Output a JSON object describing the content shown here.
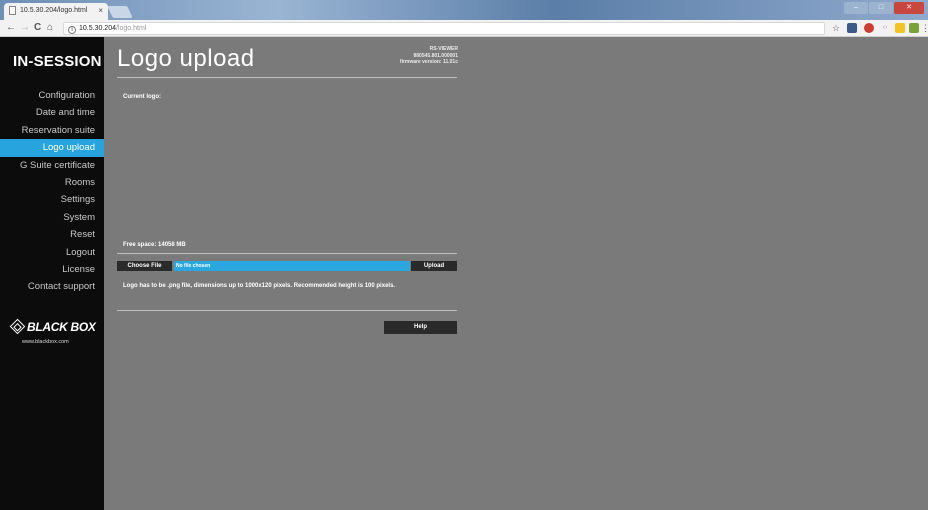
{
  "browser": {
    "tab_title": "10.5.30.204/logo.html",
    "tab_close": "×",
    "url_host": "10.5.30.204",
    "url_path": "/logo.html",
    "window_controls": {
      "minimize": "–",
      "maximize": "□",
      "close": "✕"
    },
    "nav": {
      "back": "←",
      "forward": "→",
      "reload": "C",
      "home": "⌂"
    },
    "info_icon": "i",
    "toolbar_icons": [
      "star-icon",
      "extension-icon",
      "adblock-icon",
      "code-icon",
      "notes-icon",
      "puzzle-icon",
      "menu-icon"
    ],
    "star_glyph": "☆",
    "menu_glyph": "⋮"
  },
  "sidebar": {
    "brand": "IN-SESSION",
    "items": [
      {
        "label": "Configuration",
        "active": false
      },
      {
        "label": "Date and time",
        "active": false
      },
      {
        "label": "Reservation suite",
        "active": false
      },
      {
        "label": "Logo upload",
        "active": true
      },
      {
        "label": "G Suite certificate",
        "active": false
      },
      {
        "label": "Rooms",
        "active": false
      },
      {
        "label": "Settings",
        "active": false
      },
      {
        "label": "System",
        "active": false
      },
      {
        "label": "Reset",
        "active": false
      },
      {
        "label": "Logout",
        "active": false
      },
      {
        "label": "License",
        "active": false
      },
      {
        "label": "Contact support",
        "active": false
      }
    ],
    "logo_text": "BLACK BOX",
    "logo_url": "www.blackbox.com"
  },
  "main": {
    "title": "Logo upload",
    "device": {
      "model": "RS-VIEWER",
      "serial": "880545.801.000001",
      "firmware": "firmware version: 11.01c"
    },
    "current_logo_label": "Current logo:",
    "free_space": "Free space: 14058 MB",
    "choose_file_label": "Choose File",
    "file_status": "No file chosen",
    "upload_label": "Upload",
    "note": "Logo has to be .png file, dimensions up to 1000x120 pixels. Recommended height is 100 pixels.",
    "help_label": "Help"
  },
  "colors": {
    "accent": "#27a4dd",
    "sidebar_bg": "#0c0c0c",
    "content_bg": "#7a7a7a",
    "button_bg": "#2a2a2a"
  }
}
